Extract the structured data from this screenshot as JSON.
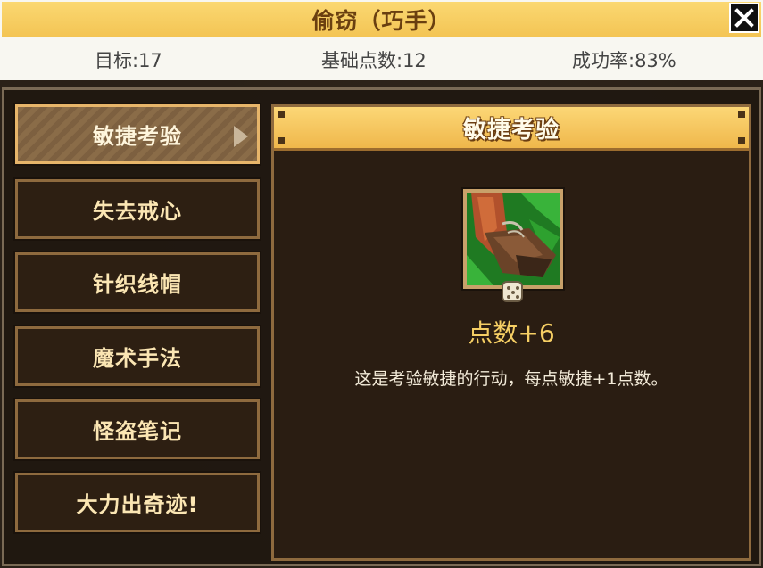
{
  "header": {
    "title": "偷窃（巧手）",
    "close_icon": "close-icon",
    "stats": {
      "target": "目标:17",
      "base_points": "基础点数:12",
      "success_rate": "成功率:83%"
    }
  },
  "menu": {
    "items": [
      {
        "label": "敏捷考验",
        "active": true
      },
      {
        "label": "失去戒心",
        "active": false
      },
      {
        "label": "针织线帽",
        "active": false
      },
      {
        "label": "魔术手法",
        "active": false
      },
      {
        "label": "怪盗笔记",
        "active": false
      },
      {
        "label": "大力出奇迹!",
        "active": false
      }
    ]
  },
  "detail": {
    "title": "敏捷考验",
    "icon": "boot-skill-icon",
    "dice_icon": "dice-icon",
    "points": "点数+6",
    "description": "这是考验敏捷的行动，每点敏捷+1点数。"
  },
  "colors": {
    "title_bar": "#f3c453",
    "title_text": "#6a3f10",
    "panel_bg": "#2a1d12",
    "menu_border": "#8e6a3e",
    "points_text": "#f6cf64"
  }
}
